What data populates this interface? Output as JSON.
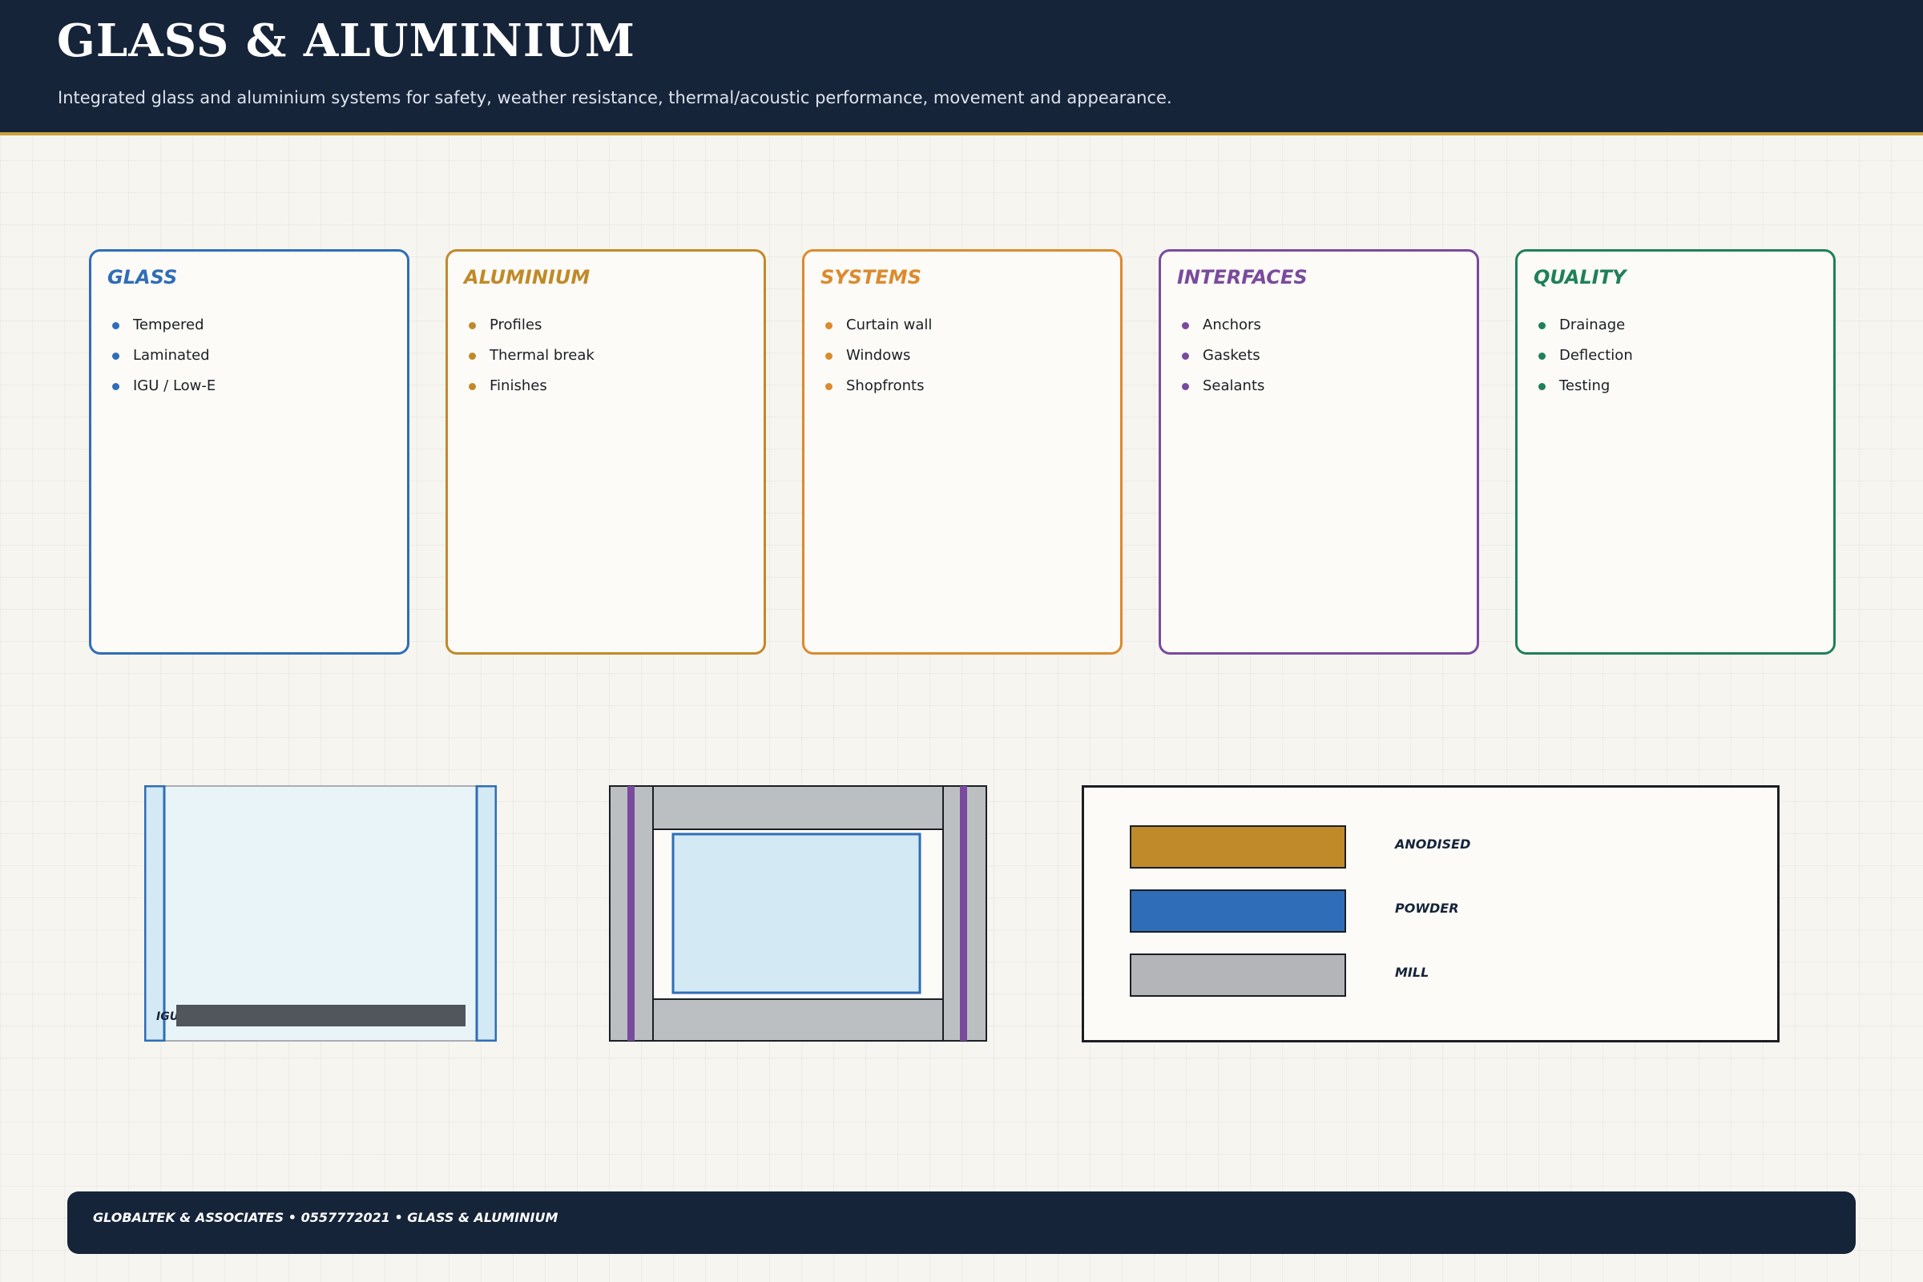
{
  "header": {
    "title": "GLASS & ALUMINIUM",
    "subtitle": "Integrated glass and aluminium systems for safety, weather resistance, thermal/acoustic performance, movement and appearance."
  },
  "cards": [
    {
      "title": "GLASS",
      "color": "#2f6db8",
      "items": [
        "Tempered",
        "Laminated",
        "IGU / Low-E"
      ]
    },
    {
      "title": "ALUMINIUM",
      "color": "#c08a2a",
      "items": [
        "Profiles",
        "Thermal break",
        "Finishes"
      ]
    },
    {
      "title": "SYSTEMS",
      "color": "#dc8a2e",
      "items": [
        "Curtain wall",
        "Windows",
        "Shopfronts"
      ]
    },
    {
      "title": "INTERFACES",
      "color": "#7a4a9e",
      "items": [
        "Anchors",
        "Gaskets",
        "Sealants"
      ]
    },
    {
      "title": "QUALITY",
      "color": "#1f8059",
      "items": [
        "Drainage",
        "Deflection",
        "Testing"
      ]
    }
  ],
  "glass_panel": {
    "label": "IGU"
  },
  "finishes": [
    {
      "label": "ANODISED",
      "color": "#c08a2a"
    },
    {
      "label": "POWDER",
      "color": "#2f6db8"
    },
    {
      "label": "MILL",
      "color": "#b3b5b8"
    }
  ],
  "footer": {
    "text": "GLOBALTEK & ASSOCIATES • 0557772021 • GLASS & ALUMINIUM"
  }
}
